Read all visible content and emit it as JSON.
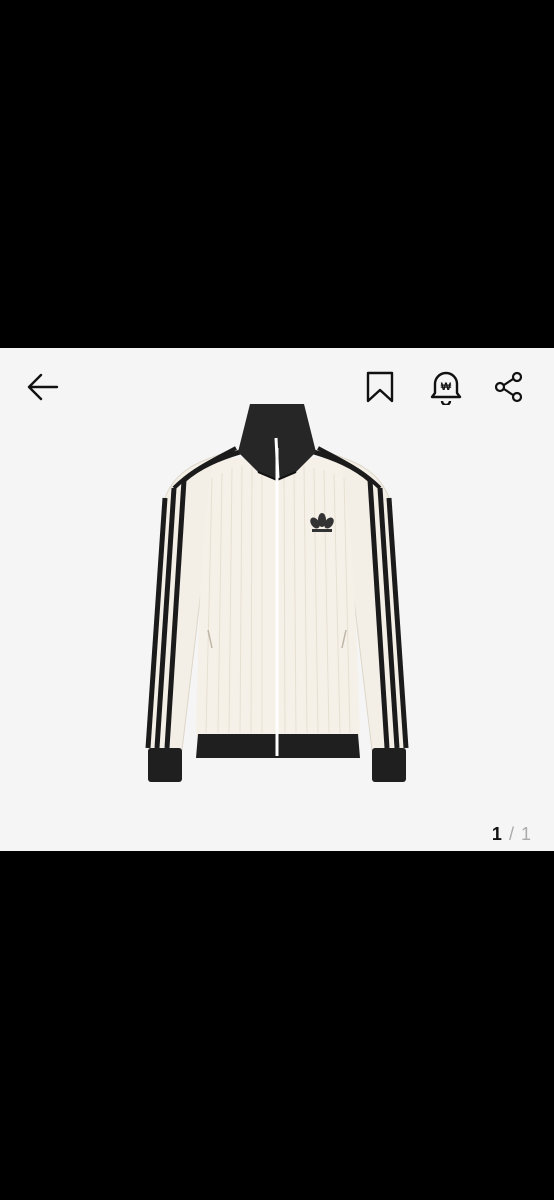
{
  "viewer": {
    "background": "#000000",
    "photo_background": "#f5f5f5",
    "image_subject": "adidas-track-jacket-cream-black",
    "counter": {
      "current": "1",
      "separator": "/",
      "total": "1"
    }
  },
  "toolbar": {
    "back_icon": "arrow-left-icon",
    "bookmark_icon": "bookmark-icon",
    "price_alert_icon": "won-bell-icon",
    "price_alert_symbol": "₩",
    "share_icon": "share-icon"
  },
  "colors": {
    "icon": "#111111",
    "counter_active": "#111111",
    "counter_muted": "#aaaaaa"
  }
}
